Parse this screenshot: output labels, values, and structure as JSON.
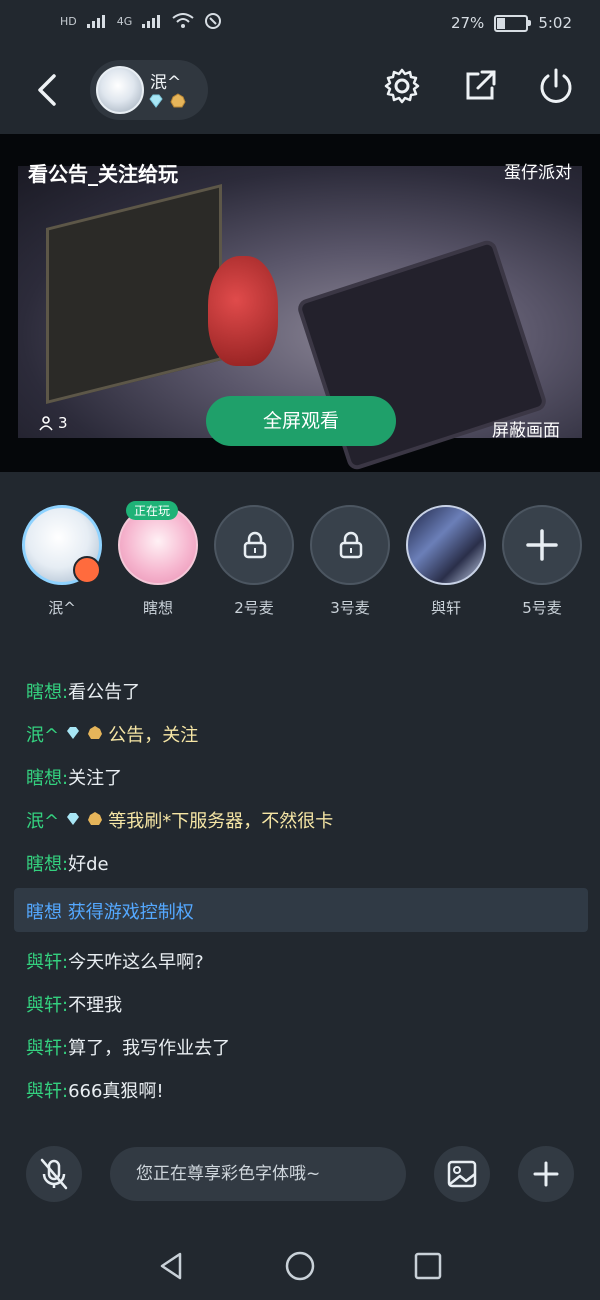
{
  "status_bar": {
    "left_icons": [
      "HD",
      "4G"
    ],
    "battery_percent": "27%",
    "battery_level": 0.27,
    "time": "5:02"
  },
  "header": {
    "user_name": "泯^"
  },
  "video": {
    "title": "看公告_关注给玩",
    "game_name": "蛋仔派对",
    "viewers": "3",
    "fullscreen_label": "全屏观看",
    "hide_label": "屏蔽画面"
  },
  "seats": [
    {
      "label": "泯^"
    },
    {
      "label": "瞎想",
      "tag": "正在玩"
    },
    {
      "label": "2号麦"
    },
    {
      "label": "3号麦"
    },
    {
      "label": "與轩"
    },
    {
      "label": "5号麦"
    }
  ],
  "chat": [
    {
      "name": "瞎想:",
      "text": "看公告了"
    },
    {
      "name": "泯^",
      "text": "公告，关注"
    },
    {
      "name": "瞎想:",
      "text": "关注了"
    },
    {
      "name": "泯^",
      "text": "等我刷*下服务器，不然很卡"
    },
    {
      "name": "瞎想:",
      "text": "好de"
    },
    {
      "name": "瞎想",
      "text": "获得游戏控制权"
    },
    {
      "name": "與轩:",
      "text": "今天咋这么早啊?"
    },
    {
      "name": "與轩:",
      "text": "不理我"
    },
    {
      "name": "與轩:",
      "text": "算了，我写作业去了"
    },
    {
      "name": "與轩:",
      "text": "666真狠啊!"
    }
  ],
  "input": {
    "placeholder": "您正在尊享彩色字体哦~"
  },
  "colors": {
    "accent_green": "#1fa06a",
    "name_green": "#34d17f",
    "system_blue": "#54a8ff",
    "background": "#22282f"
  }
}
